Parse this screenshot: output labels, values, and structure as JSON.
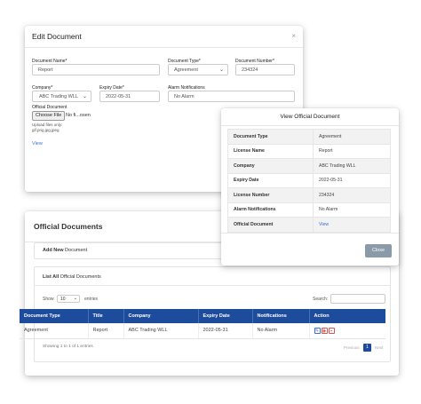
{
  "edit_modal": {
    "title": "Edit Document",
    "close": "×",
    "document_name_label": "Document Name*",
    "document_name_value": "Report",
    "document_type_label": "Document Type*",
    "document_type_value": "Agreement",
    "document_number_label": "Document Number*",
    "document_number_value": "234324",
    "company_label": "Company*",
    "company_value": "ABC Trading WLL",
    "expiry_label": "Expiry Date*",
    "expiry_value": "2022-05-31",
    "alarm_label": "Alarm Notifications",
    "alarm_value": "No Alarm",
    "official_doc_label": "Official Document",
    "choose_file": "Choose File",
    "no_file": "No fi...osen",
    "upload_hint": "Upload files only:",
    "upload_types": "gif,png,jpg,jpeg",
    "view_link": "View"
  },
  "docs_card": {
    "title": "Official Documents",
    "add_new_bold": "Add New",
    "add_new_rest": " Document",
    "list_all_bold": "List All",
    "list_all_rest": " Official Documents",
    "show_label": "Show",
    "entries_value": "10",
    "entries_label": "entries",
    "search_label": "Search:",
    "columns": [
      "Document Type",
      "Title",
      "Company",
      "Expiry Date",
      "Notifications",
      "Action"
    ],
    "rows": [
      [
        "Agreement",
        "Report",
        "ABC Trading WLL",
        "2022-05-31",
        "No Alarm"
      ]
    ],
    "showing": "Showing 1 to 1 of 1 entries",
    "previous": "Previous",
    "page": "1",
    "next": "Next"
  },
  "view_modal": {
    "title": "View Official Document",
    "rows": [
      {
        "k": "Document Type",
        "v": "Agreement"
      },
      {
        "k": "License Name",
        "v": "Report"
      },
      {
        "k": "Company",
        "v": "ABC Trading WLL"
      },
      {
        "k": "Expiry Date",
        "v": "2022-05-31"
      },
      {
        "k": "License Number",
        "v": "234324"
      },
      {
        "k": "Alarm Notifications",
        "v": "No Alarm"
      },
      {
        "k": "Official Document",
        "v": "View"
      }
    ],
    "close_button": "Close"
  },
  "colors": {
    "header_blue": "#1d4c9c",
    "link_blue": "#3d6fd1",
    "edit_action": "#3d6fd1",
    "view_action": "#d9534f",
    "delete_action": "#d9534f"
  },
  "icons": [
    "pencil-icon",
    "eye-icon",
    "trash-icon"
  ]
}
